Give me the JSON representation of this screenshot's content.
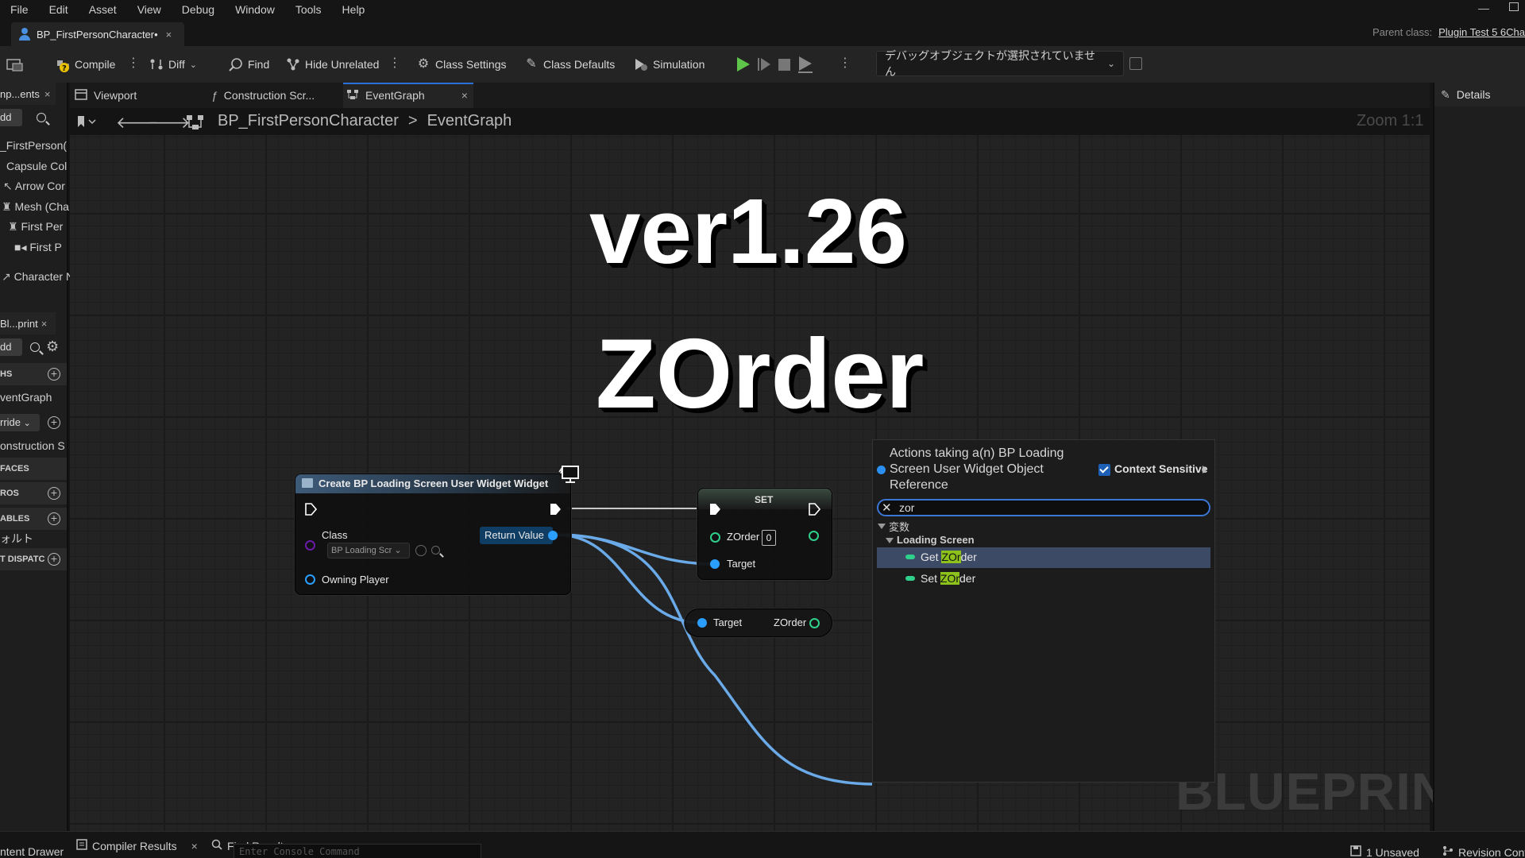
{
  "menu": [
    "File",
    "Edit",
    "Asset",
    "View",
    "Debug",
    "Window",
    "Tools",
    "Help"
  ],
  "asset_tab": {
    "label": "BP_FirstPersonCharacter•",
    "close": "×"
  },
  "parent_class": {
    "label": "Parent class:",
    "value": "Plugin Test 5 6Cha"
  },
  "toolbar": {
    "compile": "Compile",
    "diff": "Diff",
    "find": "Find",
    "hide_unrelated": "Hide Unrelated",
    "class_settings": "Class Settings",
    "class_defaults": "Class Defaults",
    "simulation": "Simulation",
    "debug_object": "デバッグオブジェクトが選択されていません"
  },
  "left_panel": {
    "components_tab": "np...ents",
    "add": "dd",
    "components": [
      "_FirstPerson(",
      "Capsule Col",
      "Arrow Cor",
      "Mesh (Cha",
      "First Per",
      "First P",
      "Character N"
    ],
    "blueprint_tab": "Bl...print",
    "sections": {
      "graphs": "HS",
      "event_graph": "ventGraph",
      "override": "rride",
      "construction": "onstruction S",
      "interfaces": "FACES",
      "macros": "ROS",
      "variables": "ABLES",
      "default": "ォルト",
      "dispatchers": "T DISPATC"
    }
  },
  "graph_tabs": {
    "viewport": "Viewport",
    "construction": "Construction Scr...",
    "eventgraph": "EventGraph"
  },
  "breadcrumb": {
    "blueprint": "BP_FirstPersonCharacter",
    "separator": ">",
    "graph": "EventGraph"
  },
  "zoom": "Zoom 1:1",
  "overlay": {
    "version": "ver1.26",
    "title": "ZOrder"
  },
  "watermark": "BLUEPRINT",
  "node_create": {
    "title": "Create BP Loading Screen User Widget Widget",
    "class_label": "Class",
    "class_value": "BP Loading Scr",
    "return_value": "Return Value",
    "owning_player": "Owning Player"
  },
  "node_set": {
    "title": "SET",
    "zorder_label": "ZOrder",
    "zorder_value": "0",
    "target_label": "Target"
  },
  "node_get": {
    "target_label": "Target",
    "zorder_label": "ZOrder"
  },
  "context_menu": {
    "title": "Actions taking a(n) BP Loading Screen User Widget Object Reference",
    "context_sensitive": "Context Sensitive",
    "search_value": "zor",
    "category": "変数",
    "subcategory": "Loading Screen",
    "items": [
      {
        "prefix": "Get ",
        "match": "ZOr",
        "suffix": "der"
      },
      {
        "prefix": "Set ",
        "match": "ZOr",
        "suffix": "der"
      }
    ]
  },
  "details": {
    "tab": "Details"
  },
  "bottom": {
    "content_drawer": "ntent Drawer",
    "compiler_results": "Compiler Results",
    "find_results": "Find Results",
    "console_placeholder": "Enter Console Command",
    "unsaved": "1 Unsaved",
    "revision": "Revision Cont"
  },
  "colors": {
    "accent_blue": "#2a70d8",
    "object_pin": "#2a9fff",
    "int_pin": "#2fd08a",
    "highlight": "#8dc11b",
    "play_green": "#5fc44a"
  }
}
